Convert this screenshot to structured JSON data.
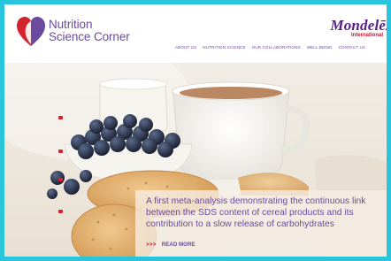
{
  "header": {
    "logo_line1": "Nutrition",
    "logo_line2": "Science Corner",
    "brand_name": "Mondelēz",
    "brand_sub": "International",
    "nav": [
      {
        "label": "ABOUT US"
      },
      {
        "label": "NUTRITION SCIENCE"
      },
      {
        "label": "OUR COLLABORATIONS"
      },
      {
        "label": "WELL BEING"
      },
      {
        "label": "CONTACT US"
      }
    ]
  },
  "hero": {
    "headline": "A first meta-analysis demonstrating the continuous link between the SDS content of cereal products and its contribution to a slow release of carbohydrates",
    "read_more_arrows": ">>>",
    "read_more_label": "READ MORE"
  },
  "colors": {
    "accent_purple": "#6b4aa0",
    "accent_red": "#c8102e",
    "frame": "#29c5dc"
  }
}
